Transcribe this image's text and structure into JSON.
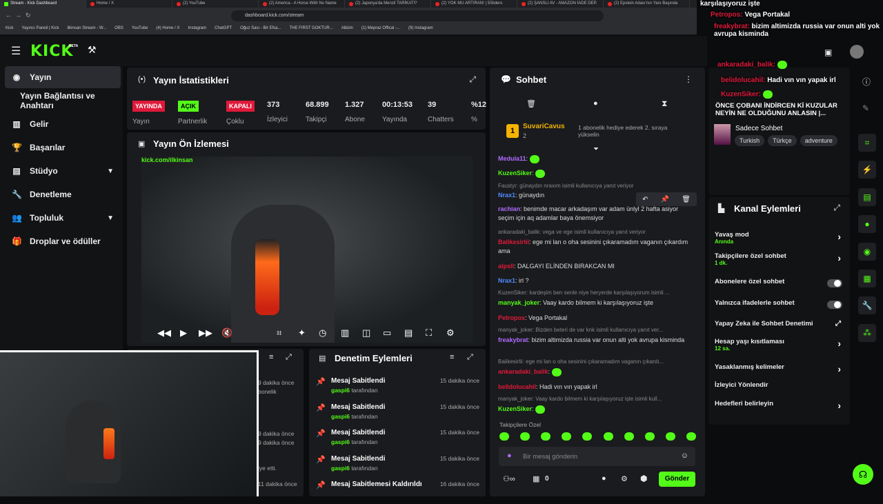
{
  "browser": {
    "tabs": [
      "Stream - Kick Dashboard",
      "Home / X",
      "(2) YouTube",
      "(2) America - A Horse With No Name",
      "(2) Japonya'da Menzil TARİKATI?",
      "(2) YOK MU ARTIRAN! | 5Sliders",
      "(2) ŞANSLI AV - AMAZON İADE DEP.",
      "(2) Epstein Adası'nın Yanı Başında"
    ],
    "url": "dashboard.kick.com/stream",
    "bookmarks": [
      "Kick",
      "Yayıncı Paneli | Kick",
      "ilkinsan Stream - W...",
      "OBS",
      "YouTube",
      "(4) Home / X",
      "Instagram",
      "ChatGPT",
      "Oğuz Sası - Bir Efsa...",
      "THE FIRST GOKTUR...",
      "Albüm",
      "(1) Mepraz Offical -...",
      "(9) Instagram"
    ]
  },
  "topbar": {
    "logo": "KICK",
    "beta": "BETA"
  },
  "sidebar": {
    "items": [
      {
        "label": "Yayın",
        "icon": "broadcast-icon"
      },
      {
        "label": "Yayın Bağlantısı ve Anahtarı",
        "icon": ""
      },
      {
        "label": "Gelir",
        "icon": "chart-icon"
      },
      {
        "label": "Başarılar",
        "icon": "trophy-icon"
      },
      {
        "label": "Stüdyo",
        "icon": "layout-icon"
      },
      {
        "label": "Denetleme",
        "icon": "wrench-icon"
      },
      {
        "label": "Topluluk",
        "icon": "people-icon"
      },
      {
        "label": "Droplar ve ödüller",
        "icon": "gift-icon"
      }
    ]
  },
  "stats": {
    "title": "Yayın İstatistikleri",
    "items": [
      {
        "value": "YAYINDA",
        "label": "Yayın",
        "color": "#e0193a"
      },
      {
        "value": "AÇIK",
        "label": "Partnerlik",
        "color": "#53fc18"
      },
      {
        "value": "KAPALI",
        "label": "Çoklu",
        "color": "#e0193a"
      },
      {
        "value": "373",
        "label": "İzleyici"
      },
      {
        "value": "68.899",
        "label": "Takipçi"
      },
      {
        "value": "1.327",
        "label": "Abone"
      },
      {
        "value": "00:13:53",
        "label": "Yayında"
      },
      {
        "value": "39",
        "label": "Chatters"
      },
      {
        "value": "%12",
        "label": "%"
      }
    ]
  },
  "preview": {
    "title": "Yayın Ön İzlemesi",
    "watermark": "kick.com/ilkinsan"
  },
  "hidden_panel": {
    "rows": [
      "9 dakika önce",
      "bonelik",
      "9 dakika önce",
      "9 dakika önce",
      "iye etti.",
      "11 dakika önce"
    ]
  },
  "moderation": {
    "title": "Denetim Eylemleri",
    "items": [
      {
        "action": "Mesaj Sabitlendi",
        "user": "gaspi6",
        "suffix": "tarafından",
        "time": "15 dakika önce"
      },
      {
        "action": "Mesaj Sabitlendi",
        "user": "gaspi6",
        "suffix": "tarafından",
        "time": "15 dakika önce"
      },
      {
        "action": "Mesaj Sabitlendi",
        "user": "gaspi6",
        "suffix": "tarafından",
        "time": "15 dakika önce"
      },
      {
        "action": "Mesaj Sabitlendi",
        "user": "gaspi6",
        "suffix": "tarafından",
        "time": "15 dakika önce"
      },
      {
        "action": "Mesaj Sabitlemesi Kaldırıldı",
        "user": "",
        "suffix": "",
        "time": "16 dakika önce"
      }
    ]
  },
  "chat": {
    "title": "Sohbet",
    "gift_user": "SuvariCavus",
    "gift_count": "2",
    "gift_text": "1 abonelik hediye ederek 2. sıraya yükselin",
    "rows": [
      {
        "type": "msg",
        "user": "Medula11",
        "color": "#b06bff",
        "text": ""
      },
      {
        "type": "msg",
        "user": "KuzenSiker",
        "color": "#53fc18",
        "text": ""
      },
      {
        "type": "reply",
        "text": "Faustyr: günaydın nraxım isimli kullanıcıya yanıt veriyor"
      },
      {
        "type": "msg",
        "user": "Nrax1",
        "color": "#4f8cff",
        "text": "günaydın"
      },
      {
        "type": "msg",
        "user": "rachian",
        "color": "#b06bff",
        "text": "benimde macar arkadaşım var adam ünlyl 2 hafta asiyor seçim için aq adamlar baya önemsiyor"
      },
      {
        "type": "reply",
        "text": "ankaradaki_balik: vega ve ege isimli kullanıcıya yanıt veriyor"
      },
      {
        "type": "msg",
        "user": "Balikesirlii",
        "color": "#e0193a",
        "text": "ege mi lan o oha sesinini çıkaramadım vaganın çıkardım ama"
      },
      {
        "type": "msg",
        "user": "alpsll",
        "color": "#e0193a",
        "text": "DALGAYI ELİNDEN BIRAKCAN MI"
      },
      {
        "type": "msg",
        "user": "Nrax1",
        "color": "#4f8cff",
        "text": "irl ?"
      },
      {
        "type": "reply",
        "text": "KuzenSiker: kardeşim ben senle niye heryerde karşılaşıyorum isimli ..."
      },
      {
        "type": "msg",
        "user": "manyak_joker",
        "color": "#53fc18",
        "text": "Vaay kardo bilmem ki karşılaşıyoruz işte"
      },
      {
        "type": "msg",
        "user": "Petropos",
        "color": "#e0193a",
        "text": "Vega Portakal"
      },
      {
        "type": "reply",
        "text": "manyak_joker: Bizden beteri de var knk isimli kullanıcıya yanıt ver..."
      },
      {
        "type": "msg",
        "user": "freakybrat",
        "color": "#b06bff",
        "text": "bizim altimizda russia var onun alti yok avrupa kisminda"
      },
      {
        "type": "reply",
        "text": "Balikesirlii: ege mi lan o oha sesinini çıkaramadım vaganın çıkardı..."
      },
      {
        "type": "msg",
        "user": "ankaradaki_balik",
        "color": "#e0193a",
        "text": ""
      },
      {
        "type": "msg",
        "user": "belidolucahil",
        "color": "#e0193a",
        "text": "Hadi vın vın yapak irl"
      },
      {
        "type": "reply",
        "text": "manyak_joker: Vaay kardo bilmem ki karşılaşıyoruz işte isimli kull..."
      },
      {
        "type": "msg",
        "user": "KuzenSiker",
        "color": "#53fc18",
        "text": ""
      }
    ],
    "followers_only": "Takipçilere Özel",
    "placeholder": "Bir mesaj gönderin",
    "points": "0",
    "send": "Gönder"
  },
  "stream_info": {
    "title": "ÖNCE ÇOBANI İNDİRCEN Kİ KUZULAR NEYİN NE OLDUĞUNU ANLASIN |...",
    "category": "Sadece Sohbet",
    "tags": [
      "Turkish",
      "Türkçe",
      "adventure"
    ]
  },
  "channel_actions": {
    "title": "Kanal Eylemleri",
    "items": [
      {
        "label": "Yavaş mod",
        "sub": "Anında",
        "ctrl": "chevron"
      },
      {
        "label": "Takipçilere özel sohbet",
        "sub": "1 dk.",
        "ctrl": "chevron"
      },
      {
        "label": "Abonelere özel sohbet",
        "sub": "",
        "ctrl": "toggle"
      },
      {
        "label": "Yalnızca ifadelerle sohbet",
        "sub": "",
        "ctrl": "toggle"
      },
      {
        "label": "Yapay Zeka ile Sohbet Denetimi",
        "sub": "",
        "ctrl": "external"
      },
      {
        "label": "Hesap yaşı kısıtlaması",
        "sub": "12 sa.",
        "ctrl": "chevron"
      },
      {
        "label": "Yasaklanmış kelimeler",
        "sub": "",
        "ctrl": "chevron"
      },
      {
        "label": "İzleyici Yönlendir",
        "sub": "",
        "ctrl": ""
      },
      {
        "label": "Hedefleri belirleyin",
        "sub": "",
        "ctrl": "chevron"
      }
    ]
  },
  "overlay": {
    "lines": [
      {
        "user": "",
        "text": "karşılaşıyoruz işte"
      },
      {
        "user": "Petropos:",
        "text": "Vega Portakal"
      },
      {
        "user": "freakybrat:",
        "text": "bizim altimizda russia var onun alti yok avrupa kisminda"
      },
      {
        "user": "ankaradaki_balik:",
        "text": ""
      },
      {
        "user": "belidolucahil:",
        "text": "Hadi vın vın yapak irl"
      },
      {
        "user": "KuzenSiker:",
        "text": ""
      }
    ]
  },
  "colors": {
    "accent": "#53fc18",
    "live": "#e0193a",
    "panel": "#1a1b1e"
  }
}
